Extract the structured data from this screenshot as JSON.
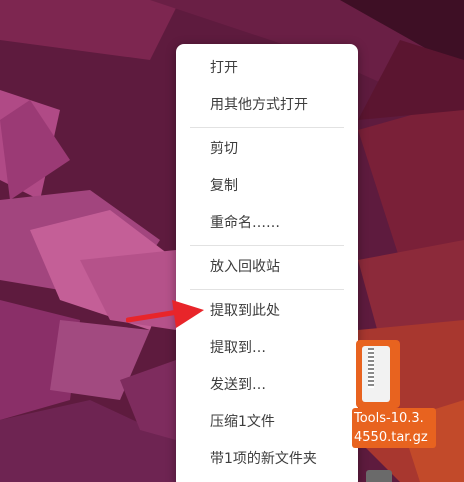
{
  "context_menu": {
    "items": [
      {
        "label": "打开"
      },
      {
        "label": "用其他方式打开"
      },
      {
        "label": "剪切"
      },
      {
        "label": "复制"
      },
      {
        "label": "重命名……"
      },
      {
        "label": "放入回收站"
      },
      {
        "label": "提取到此处"
      },
      {
        "label": "提取到…"
      },
      {
        "label": "发送到…"
      },
      {
        "label": "压缩1文件"
      },
      {
        "label": "带1项的新文件夹"
      }
    ]
  },
  "desktop_file": {
    "name_line1": "Tools-10.3.",
    "name_line2": "4550.tar.gz",
    "icon": "archive-file-icon"
  },
  "annotation": {
    "icon": "red-arrow-icon",
    "color": "#e8252a"
  },
  "colors": {
    "selection_accent": "#e8631f",
    "menu_background": "#ffffff",
    "menu_text": "#3d3d3d"
  }
}
